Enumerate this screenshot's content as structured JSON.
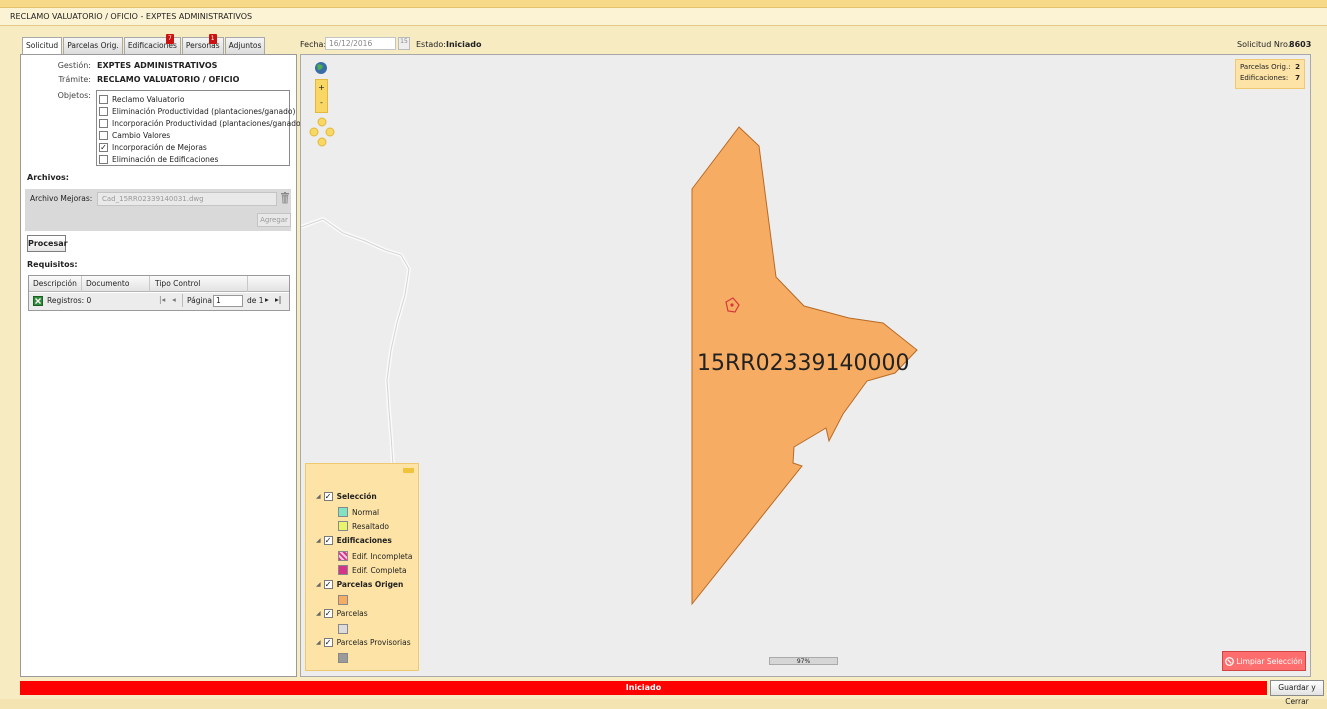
{
  "window": {
    "title": "RECLAMO VALUATORIO / OFICIO  -  EXPTES ADMINISTRATIVOS"
  },
  "tabs": [
    {
      "label": "Solicitud",
      "badge": ""
    },
    {
      "label": "Parcelas Orig.",
      "badge": ""
    },
    {
      "label": "Edificaciones",
      "badge": "7"
    },
    {
      "label": "Personas",
      "badge": "1"
    },
    {
      "label": "Adjuntos",
      "badge": ""
    }
  ],
  "header": {
    "fecha_label": "Fecha:",
    "fecha_value": "16/12/2016",
    "calendar_icon": "15",
    "estado_label": "Estado:",
    "estado_value": "Iniciado",
    "solicitud_label": "Solicitud Nro.:",
    "solicitud_value": "8603"
  },
  "form": {
    "gestion_label": "Gestión:",
    "gestion_value": "EXPTES ADMINISTRATIVOS",
    "tramite_label": "Trámite:",
    "tramite_value": "RECLAMO VALUATORIO / OFICIO",
    "objetos_label": "Objetos:",
    "objetos": [
      {
        "label": "Reclamo Valuatorio",
        "checked": false
      },
      {
        "label": "Eliminación Productividad (plantaciones/ganado)",
        "checked": false
      },
      {
        "label": "Incorporación Productividad (plantaciones/ganado",
        "checked": false
      },
      {
        "label": "Cambio Valores",
        "checked": false
      },
      {
        "label": "Incorporación de Mejoras",
        "checked": true
      },
      {
        "label": "Eliminación de Edificaciones",
        "checked": false
      }
    ],
    "archivos_title": "Archivos:",
    "archivo_mejoras_label": "Archivo Mejoras:",
    "archivo_mejoras_value": "Cad_15RR02339140031.dwg",
    "agregar_label": "Agregar",
    "procesar_label": "Procesar",
    "requisitos_title": "Requisitos:"
  },
  "requisitos_grid": {
    "columns": [
      "Descripción",
      "Documento",
      "Tipo Control"
    ],
    "registros_label": "Registros: 0",
    "pagina_label": "Página",
    "pagina_value": "1",
    "de_label": "de 1"
  },
  "map": {
    "parcel_label": "15RR02339140000",
    "summary": {
      "parcelas_label": "Parcelas Orig.:",
      "parcelas_value": "2",
      "edificaciones_label": "Edificaciones:",
      "edificaciones_value": "7"
    },
    "zoom_in": "+",
    "zoom_out": "-",
    "progress": "97%",
    "clear_label": "Limpiar Selección",
    "legend": {
      "seleccion": "Selección",
      "normal": "Normal",
      "resaltado": "Resaltado",
      "edificaciones": "Edificaciones",
      "edif_incompleta": "Edif. Incompleta",
      "edif_completa": "Edif. Completa",
      "parcelas_origen": "Parcelas Origen",
      "parcelas": "Parcelas",
      "parcelas_provisorias": "Parcelas Provisorias"
    },
    "colors": {
      "parcel_fill": "#f6ad63",
      "parcel_stroke": "#b96a25",
      "status_bar": "#ff0000"
    }
  },
  "status": {
    "label": "Iniciado"
  },
  "footer": {
    "save_close_label": "Guardar y Cerrar"
  }
}
